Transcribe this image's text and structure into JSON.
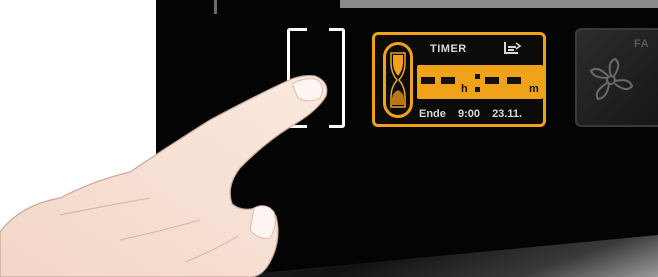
{
  "timer": {
    "title": "TIMER",
    "hours_unit": "h",
    "minutes_unit": "m",
    "end_label": "Ende",
    "end_time": "9:00",
    "end_date": "23.11.",
    "accent_color": "#f0a21a"
  },
  "fan_tile": {
    "title_partial": "FA"
  },
  "colors": {
    "panel_background": "#040404",
    "bracket": "#ffffff",
    "tile_text": "#d8d8d8"
  },
  "icons": [
    "hourglass-icon",
    "timer-mode-icon",
    "fan-icon"
  ]
}
